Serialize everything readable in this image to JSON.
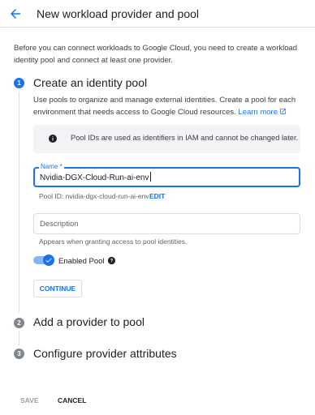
{
  "header": {
    "back_icon": "arrow-back-icon",
    "title": "New workload provider and pool"
  },
  "intro": "Before you can connect workloads to Google Cloud, you need to create a workload identity pool and connect at least one provider.",
  "steps": [
    {
      "number": "1",
      "title": "Create an identity pool",
      "description": "Use pools to organize and manage external identities. Create a pool for each environment that needs access to Google Cloud resources.",
      "learn_more": "Learn more",
      "learn_more_icon": "open-in-new-icon",
      "info_icon": "info-icon",
      "info_text": "Pool IDs are used as identifiers in IAM and cannot be changed later.",
      "name_label": "Name *",
      "name_value": "Nvidia-DGX-Cloud-Run-ai-env",
      "pool_id": "Pool ID: nvidia-dgx-cloud-run-ai-env",
      "edit_label": "EDIT",
      "description_placeholder": "Description",
      "description_hint": "Appears when granting access to pool identities.",
      "enabled_label": "Enabled Pool",
      "enabled": true,
      "help_icon": "help-icon",
      "continue_label": "CONTINUE"
    },
    {
      "number": "2",
      "title": "Add a provider to pool"
    },
    {
      "number": "3",
      "title": "Configure provider attributes"
    }
  ],
  "footer": {
    "save_label": "SAVE",
    "cancel_label": "CANCEL"
  },
  "colors": {
    "accent": "#1a73e8",
    "inactive_step": "#80868b",
    "info_bg": "#f1f3f4"
  }
}
